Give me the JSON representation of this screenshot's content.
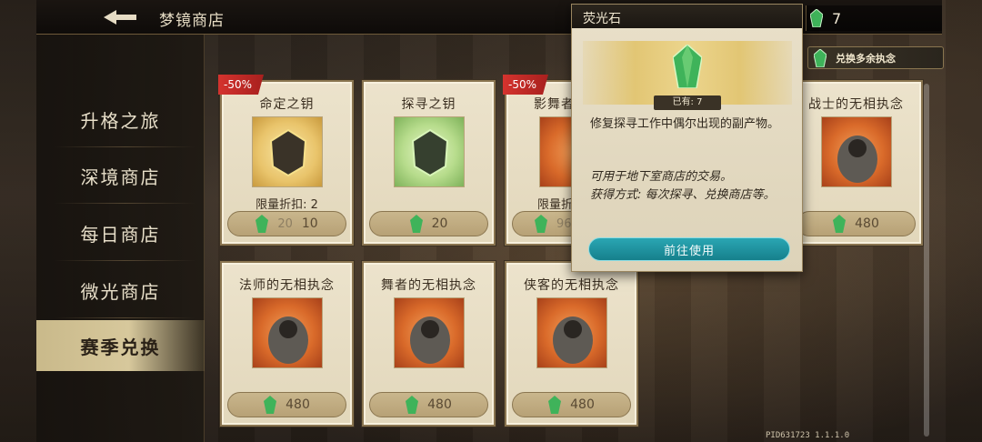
{
  "header": {
    "title": "梦镜商店",
    "currency_amount": "7",
    "exchange_label": "兑换多余执念"
  },
  "sidebar": {
    "items": [
      {
        "label": "升格之旅",
        "active": false
      },
      {
        "label": "深境商店",
        "active": false
      },
      {
        "label": "每日商店",
        "active": false
      },
      {
        "label": "微光商店",
        "active": false
      },
      {
        "label": "赛季兑换",
        "active": true
      }
    ]
  },
  "cards": [
    {
      "name": "命定之钥",
      "discount": "-50%",
      "limit": "限量折扣: 2",
      "old_price": "20",
      "price": "10"
    },
    {
      "name": "探寻之钥",
      "price": "20"
    },
    {
      "name": "影舞者",
      "discount": "-50%",
      "limit": "限量折",
      "old_price": "96"
    },
    {
      "name": "战士的无相执念",
      "price": "480"
    },
    {
      "name": "法师的无相执念",
      "price": "480"
    },
    {
      "name": "舞者的无相执念",
      "price": "480"
    },
    {
      "name": "侠客的无相执念",
      "price": "480"
    }
  ],
  "popup": {
    "title": "荧光石",
    "owned": "已有: 7",
    "description": "修复探寻工作中偶尔出现的副产物。",
    "usage": "可用于地下室商店的交易。",
    "source": "获得方式: 每次探寻、兑换商店等。",
    "button_label": "前往使用"
  },
  "footer": {
    "build_id": "PID631723  1.1.1.0"
  },
  "colors": {
    "accent_teal": "#1f95a2",
    "discount_red": "#c22b27",
    "gem_green": "#3fb35a"
  }
}
